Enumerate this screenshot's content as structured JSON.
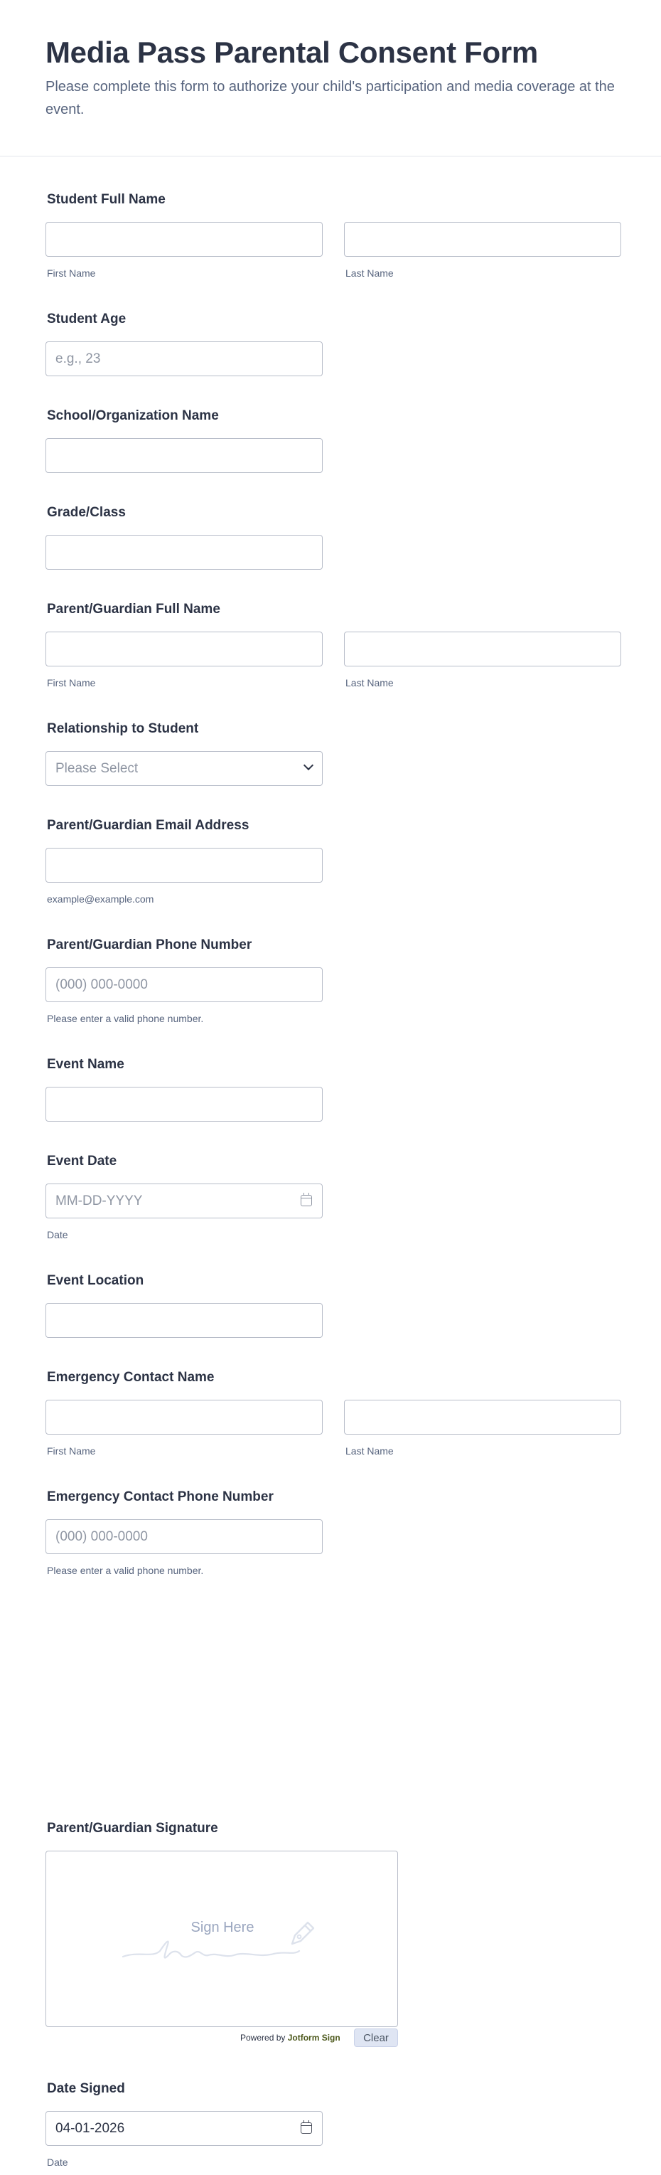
{
  "form": {
    "title": "Media Pass Parental Consent Form",
    "subtitle": "Please complete this form to authorize your child's participation and media coverage at the event."
  },
  "student_name": {
    "label": "Student Full Name",
    "first_sub": "First Name",
    "last_sub": "Last Name"
  },
  "student_age": {
    "label": "Student Age",
    "placeholder": "e.g., 23"
  },
  "school": {
    "label": "School/Organization Name"
  },
  "grade": {
    "label": "Grade/Class"
  },
  "guardian_name": {
    "label": "Parent/Guardian Full Name",
    "first_sub": "First Name",
    "last_sub": "Last Name"
  },
  "relationship": {
    "label": "Relationship to Student",
    "selected": "Please Select"
  },
  "guardian_email": {
    "label": "Parent/Guardian Email Address",
    "sub": "example@example.com"
  },
  "guardian_phone": {
    "label": "Parent/Guardian Phone Number",
    "placeholder": "(000) 000-0000",
    "sub": "Please enter a valid phone number."
  },
  "event_name": {
    "label": "Event Name"
  },
  "event_date": {
    "label": "Event Date",
    "placeholder": "MM-DD-YYYY",
    "sub": "Date"
  },
  "event_location": {
    "label": "Event Location"
  },
  "emergency_name": {
    "label": "Emergency Contact Name",
    "first_sub": "First Name",
    "last_sub": "Last Name"
  },
  "emergency_phone": {
    "label": "Emergency Contact Phone Number",
    "placeholder": "(000) 000-0000",
    "sub": "Please enter a valid phone number."
  },
  "signature": {
    "label": "Parent/Guardian Signature",
    "prompt": "Sign Here",
    "powered_prefix": "Powered by",
    "powered_brand": "Jotform Sign",
    "clear_label": "Clear"
  },
  "date_signed": {
    "label": "Date Signed",
    "value": "04-01-2026",
    "sub": "Date"
  },
  "icons": {
    "dropdown": "chevron-down-icon",
    "calendar": "calendar-icon",
    "signature": "pen-nib-icon"
  }
}
